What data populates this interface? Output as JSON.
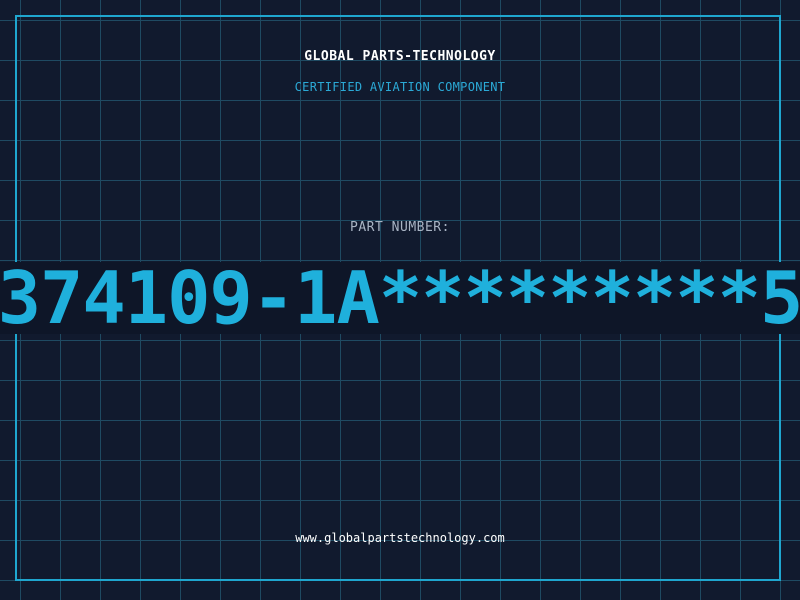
{
  "header": {
    "company": "GLOBAL PARTS-TECHNOLOGY",
    "tagline": "CERTIFIED AVIATION COMPONENT"
  },
  "part": {
    "label": "PART NUMBER:",
    "number": "374109-1A*********5"
  },
  "footer": {
    "website": "www.globalpartstechnology.com"
  },
  "colors": {
    "background": "#111a2e",
    "grid": "#1f4a62",
    "accent": "#1fb0dc",
    "frame": "#1fa6cf"
  }
}
